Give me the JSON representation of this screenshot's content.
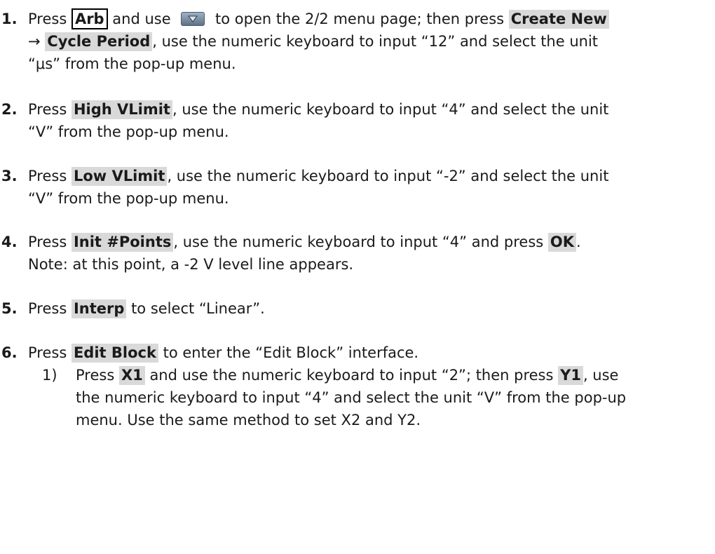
{
  "steps": [
    {
      "number": "1.",
      "l1_press": "Press ",
      "l1_arb": "Arb",
      "l1_and_use": " and use ",
      "l1_open": " to open the 2/2 menu page; then press ",
      "l1_create_new": "Create New",
      "l2_arrow": "→ ",
      "l2_cycle_period": "Cycle Period",
      "l2_rest": ", use the numeric keyboard to input “12” and select the unit",
      "l3": "“μs” from the pop-up menu."
    },
    {
      "number": "2.",
      "l1_press": "Press ",
      "l1_key": "High VLimit",
      "l1_rest": ", use the numeric keyboard to input “4” and select the unit",
      "l2": "“V” from the pop-up menu."
    },
    {
      "number": "3.",
      "l1_press": "Press ",
      "l1_key": "Low VLimit",
      "l1_rest": ", use the numeric keyboard to input “-2” and select the unit",
      "l2": "“V” from the pop-up menu."
    },
    {
      "number": "4.",
      "l1_press": "Press ",
      "l1_key": "Init #Points",
      "l1_rest": ", use the numeric keyboard to input “4” and press ",
      "l1_ok": "OK",
      "l1_end": ".",
      "l2": "Note: at this point, a -2 V level line appears."
    },
    {
      "number": "5.",
      "l1_press": "Press ",
      "l1_key": "Interp",
      "l1_rest": " to select “Linear”."
    },
    {
      "number": "6.",
      "l1_press": "Press ",
      "l1_key": "Edit Block",
      "l1_rest": " to enter the “Edit Block” interface.",
      "sub": {
        "number": "1)",
        "l1_press": "Press ",
        "l1_x1": "X1",
        "l1_mid": " and use the numeric keyboard to input “2”; then press ",
        "l1_y1": "Y1",
        "l1_end": ", use",
        "l2": "the numeric keyboard to input “4” and select the unit “V” from the pop-up",
        "l3": "menu. Use the same method to set X2 and Y2."
      }
    }
  ],
  "icons": {
    "down_button": "menu-down-arrow-icon"
  }
}
